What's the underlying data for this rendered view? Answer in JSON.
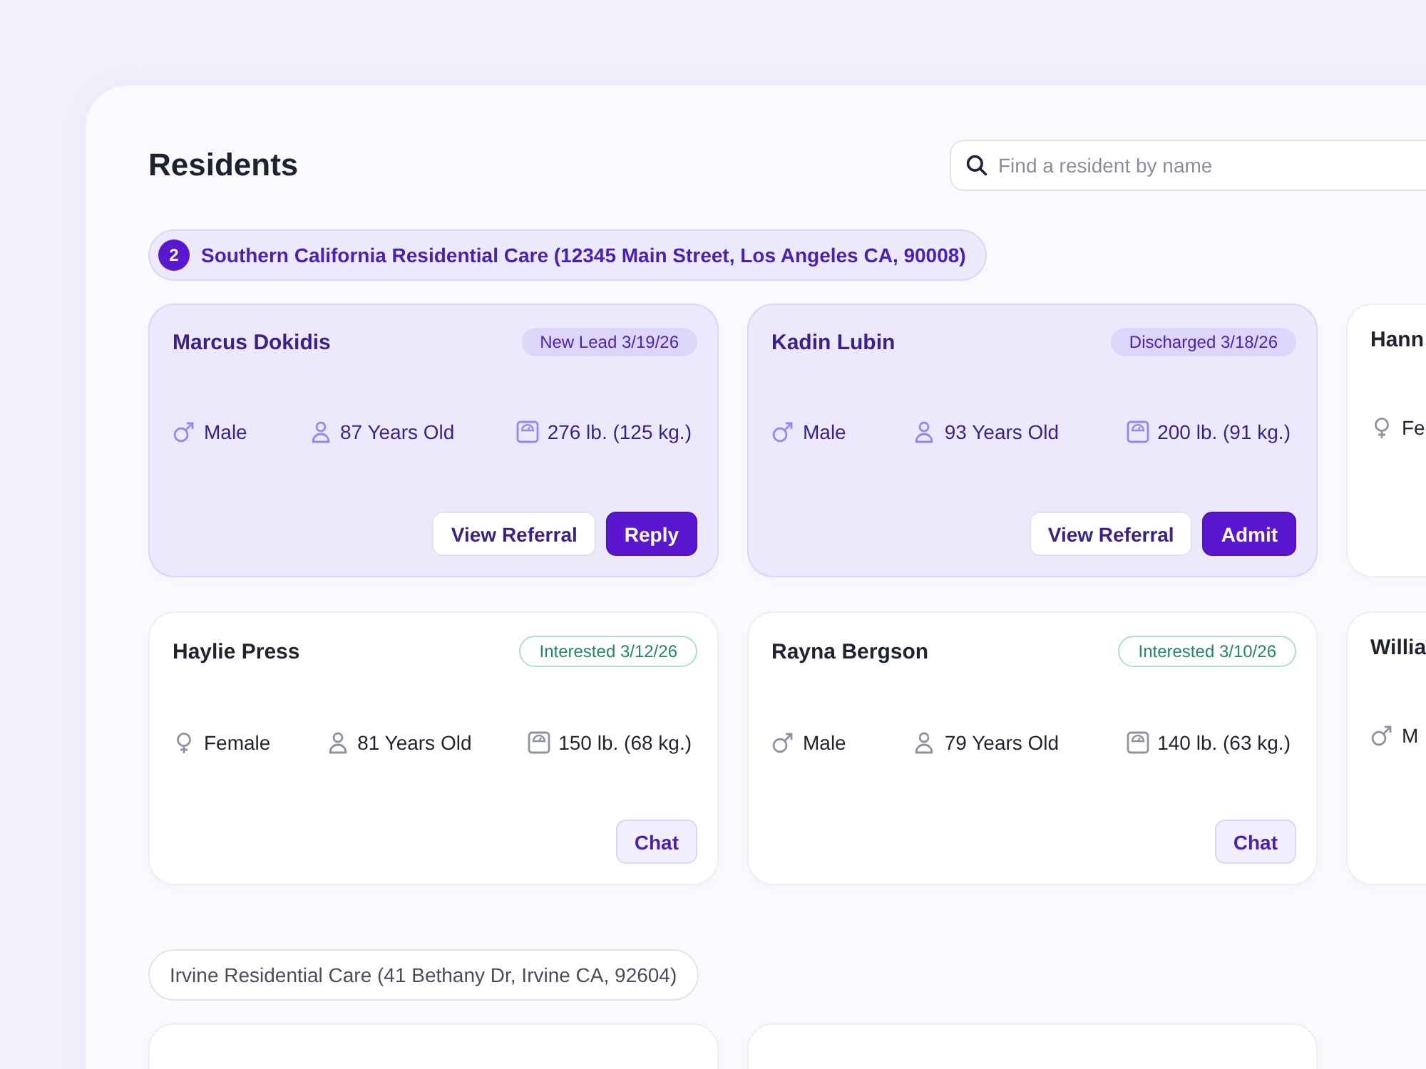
{
  "page": {
    "title": "Residents"
  },
  "search": {
    "placeholder": "Find a resident by name"
  },
  "groups": [
    {
      "count": "2",
      "label": "Southern California Residential Care (12345 Main Street, Los Angeles CA, 90008)",
      "highlighted": true,
      "residents": [
        {
          "name": "Marcus Dokidis",
          "highlighted": true,
          "status": {
            "kind": "purple",
            "text": "New Lead 3/19/26"
          },
          "kind": "male",
          "gender": "Male",
          "age": "87 Years Old",
          "weight": "276 lb. (125 kg.)",
          "buttons": [
            {
              "kind": "secondary",
              "label": "View Referral"
            },
            {
              "kind": "primary",
              "label": "Reply"
            }
          ]
        },
        {
          "name": "Kadin Lubin",
          "highlighted": true,
          "status": {
            "kind": "purple",
            "text": "Discharged 3/18/26"
          },
          "kind": "male",
          "gender": "Male",
          "age": "93 Years Old",
          "weight": "200 lb. (91 kg.)",
          "buttons": [
            {
              "kind": "secondary",
              "label": "View Referral"
            },
            {
              "kind": "primary",
              "label": "Admit"
            }
          ]
        },
        {
          "name": "Hann",
          "highlighted": false,
          "kind": "female",
          "gender": "Fe"
        },
        {
          "name": "Haylie Press",
          "highlighted": false,
          "status": {
            "kind": "green",
            "text": "Interested 3/12/26"
          },
          "kind": "female",
          "gender": "Female",
          "age": "81 Years Old",
          "weight": "150 lb. (68 kg.)",
          "buttons": [
            {
              "kind": "soft",
              "label": "Chat"
            }
          ]
        },
        {
          "name": "Rayna Bergson",
          "highlighted": false,
          "status": {
            "kind": "green",
            "text": "Interested 3/10/26"
          },
          "kind": "male",
          "gender": "Male",
          "age": "79 Years Old",
          "weight": "140 lb. (63 kg.)",
          "buttons": [
            {
              "kind": "soft",
              "label": "Chat"
            }
          ]
        },
        {
          "name": "Willia",
          "highlighted": false,
          "kind": "male",
          "gender": "M"
        }
      ]
    },
    {
      "label": "Irvine Residential Care (41 Bethany Dr, Irvine CA, 92604)",
      "highlighted": false
    }
  ]
}
